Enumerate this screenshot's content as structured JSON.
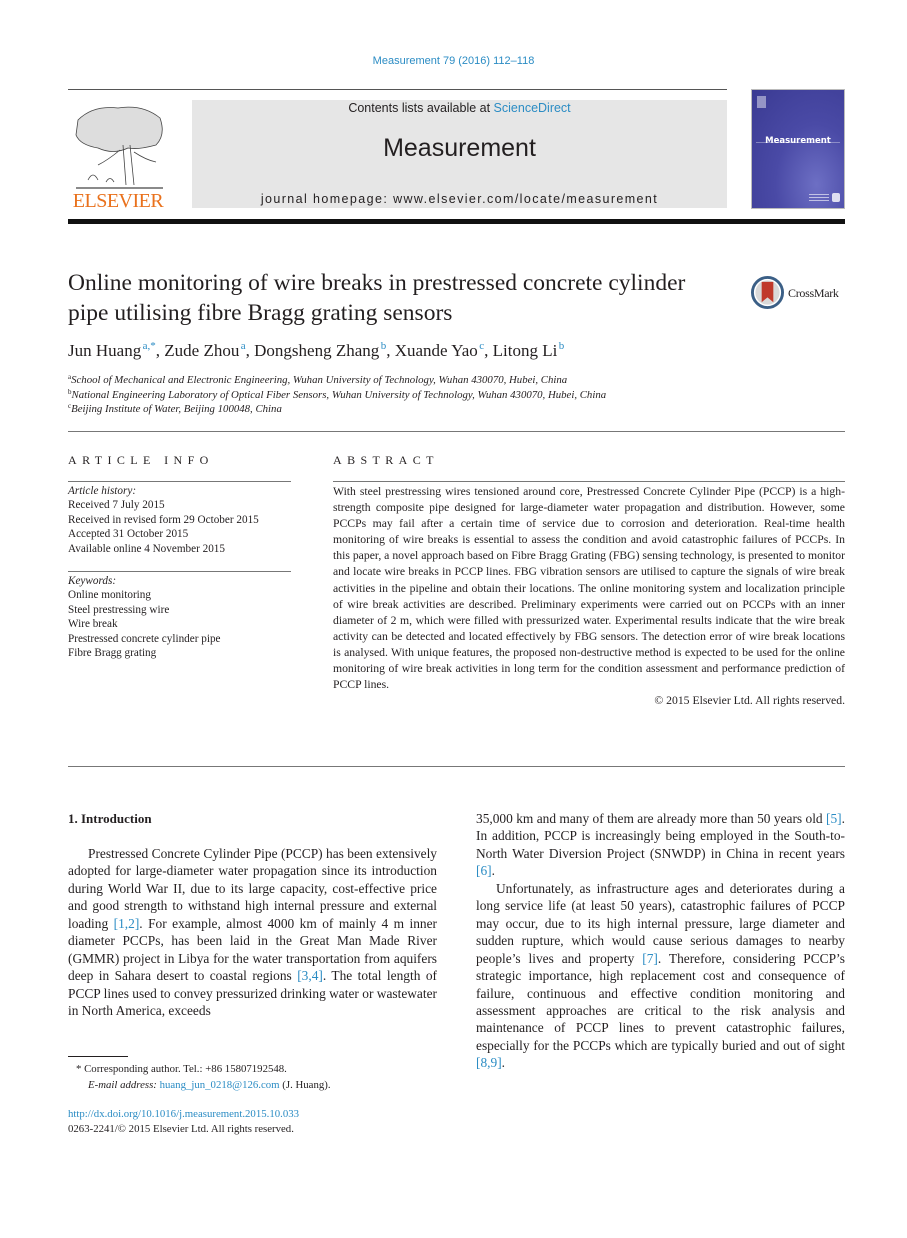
{
  "header": {
    "journal_ref": "Measurement 79 (2016) 112–118",
    "contents_prefix": "Contents lists available at ",
    "contents_link": "ScienceDirect",
    "journal_name": "Measurement",
    "homepage_prefix": "journal homepage: ",
    "homepage_url": "www.elsevier.com/locate/measurement",
    "publisher_logo_text": "ELSEVIER",
    "cover_title": "Measurement",
    "crossmark_label": "CrossMark"
  },
  "article": {
    "title": "Online monitoring of wire breaks in prestressed concrete cylinder pipe utilising fibre Bragg grating sensors",
    "authors": [
      {
        "name": "Jun Huang",
        "affil": "a,*"
      },
      {
        "name": "Zude Zhou",
        "affil": "a"
      },
      {
        "name": "Dongsheng Zhang",
        "affil": "b"
      },
      {
        "name": "Xuande Yao",
        "affil": "c"
      },
      {
        "name": "Litong Li",
        "affil": "b"
      }
    ],
    "affiliations": [
      {
        "key": "a",
        "text": "School of Mechanical and Electronic Engineering, Wuhan University of Technology, Wuhan 430070, Hubei, China"
      },
      {
        "key": "b",
        "text": "National Engineering Laboratory of Optical Fiber Sensors, Wuhan University of Technology, Wuhan 430070, Hubei, China"
      },
      {
        "key": "c",
        "text": "Beijing Institute of Water, Beijing 100048, China"
      }
    ]
  },
  "article_info": {
    "heading": "ARTICLE INFO",
    "history_label": "Article history:",
    "history": [
      "Received 7 July 2015",
      "Received in revised form 29 October 2015",
      "Accepted 31 October 2015",
      "Available online 4 November 2015"
    ],
    "keywords_label": "Keywords:",
    "keywords": [
      "Online monitoring",
      "Steel prestressing wire",
      "Wire break",
      "Prestressed concrete cylinder pipe",
      "Fibre Bragg grating"
    ]
  },
  "abstract": {
    "heading": "ABSTRACT",
    "text": "With steel prestressing wires tensioned around core, Prestressed Concrete Cylinder Pipe (PCCP) is a high-strength composite pipe designed for large-diameter water propagation and distribution. However, some PCCPs may fail after a certain time of service due to corrosion and deterioration. Real-time health monitoring of wire breaks is essential to assess the condition and avoid catastrophic failures of PCCPs. In this paper, a novel approach based on Fibre Bragg Grating (FBG) sensing technology, is presented to monitor and locate wire breaks in PCCP lines. FBG vibration sensors are utilised to capture the signals of wire break activities in the pipeline and obtain their locations. The online monitoring system and localization principle of wire break activities are described. Preliminary experiments were carried out on PCCPs with an inner diameter of 2 m, which were filled with pressurized water. Experimental results indicate that the wire break activity can be detected and located effectively by FBG sensors. The detection error of wire break locations is analysed. With unique features, the proposed non-destructive method is expected to be used for the online monitoring of wire break activities in long term for the condition assessment and performance prediction of PCCP lines.",
    "copyright": "© 2015 Elsevier Ltd. All rights reserved."
  },
  "introduction": {
    "heading": "1. Introduction",
    "col1": [
      {
        "t": "Prestressed Concrete Cylinder Pipe (PCCP) has been extensively adopted for large-diameter water propagation since its introduction during World War II, due to its large capacity, cost-effective price and good strength to withstand high internal pressure and external loading "
      },
      {
        "ref": "[1,2]"
      },
      {
        "t": ". For example, almost 4000 km of mainly 4 m inner diameter PCCPs, has been laid in the Great Man Made River (GMMR) project in Libya for the water transportation from aquifers deep in Sahara desert to coastal regions "
      },
      {
        "ref": "[3,4]"
      },
      {
        "t": ". The total length of PCCP lines used to convey pressurized drinking water or wastewater in North America, exceeds"
      }
    ],
    "col2_p1": [
      {
        "t": "35,000 km and many of them are already more than 50 years old "
      },
      {
        "ref": "[5]"
      },
      {
        "t": ". In addition, PCCP is increasingly being employed in the South-to-North Water Diversion Project (SNWDP) in China in recent years "
      },
      {
        "ref": "[6]"
      },
      {
        "t": "."
      }
    ],
    "col2_p2": [
      {
        "t": "Unfortunately, as infrastructure ages and deteriorates during a long service life (at least 50 years), catastrophic failures of PCCP may occur, due to its high internal pressure, large diameter and sudden rupture, which would cause serious damages to nearby people’s lives and property "
      },
      {
        "ref": "[7]"
      },
      {
        "t": ". Therefore, considering PCCP’s strategic importance, high replacement cost and consequence of failure, continuous and effective condition monitoring and assessment approaches are critical to the risk analysis and maintenance of PCCP lines to prevent catastrophic failures, especially for the PCCPs which are typically buried and out of sight "
      },
      {
        "ref": "[8,9]"
      },
      {
        "t": "."
      }
    ]
  },
  "footnote": {
    "marker": "*",
    "corresponding": "Corresponding author. Tel.: +86 15807192548.",
    "email_label": "E-mail address: ",
    "email": "huang_jun_0218@126.com",
    "email_suffix": " (J. Huang)."
  },
  "doi": {
    "url": "http://dx.doi.org/10.1016/j.measurement.2015.10.033",
    "rights": "0263-2241/© 2015 Elsevier Ltd. All rights reserved."
  },
  "colors": {
    "link": "#2b8cc4",
    "elsevier_orange": "#e9711c",
    "banner_gray": "#e6e6e6",
    "cover_blue": "#4a4aa6",
    "crossmark_red": "#c0392b"
  }
}
